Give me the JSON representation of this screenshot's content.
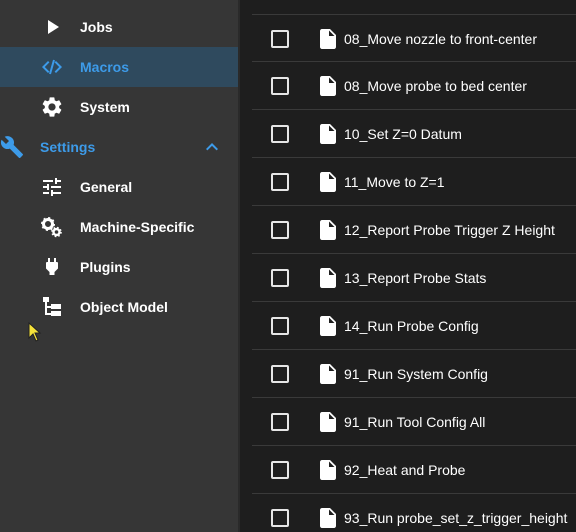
{
  "sidebar": {
    "items": [
      {
        "label": "Jobs",
        "icon": "play-icon"
      },
      {
        "label": "Macros",
        "icon": "code-icon",
        "active": true
      },
      {
        "label": "System",
        "icon": "gear-icon"
      },
      {
        "label": "Settings",
        "icon": "wrench-icon",
        "group": true,
        "expanded": true
      },
      {
        "label": "General",
        "icon": "tune-icon"
      },
      {
        "label": "Machine-Specific",
        "icon": "cogs-icon"
      },
      {
        "label": "Plugins",
        "icon": "power-plug-icon"
      },
      {
        "label": "Object Model",
        "icon": "file-tree-icon"
      }
    ]
  },
  "macros": {
    "rows": [
      {
        "name": "08_Move nozzle to front-center"
      },
      {
        "name": "08_Move probe to bed center"
      },
      {
        "name": "10_Set Z=0 Datum"
      },
      {
        "name": "11_Move to Z=1"
      },
      {
        "name": "12_Report Probe Trigger Z Height"
      },
      {
        "name": "13_Report Probe Stats"
      },
      {
        "name": "14_Run Probe Config"
      },
      {
        "name": "91_Run System Config"
      },
      {
        "name": "91_Run Tool Config All"
      },
      {
        "name": "92_Heat and Probe"
      },
      {
        "name": "93_Run probe_set_z_trigger_height"
      }
    ]
  },
  "colors": {
    "sidebar_bg": "#363636",
    "active_bg": "#2f4a5e",
    "accent": "#3d9be9",
    "main_bg": "#1e1e1e"
  }
}
